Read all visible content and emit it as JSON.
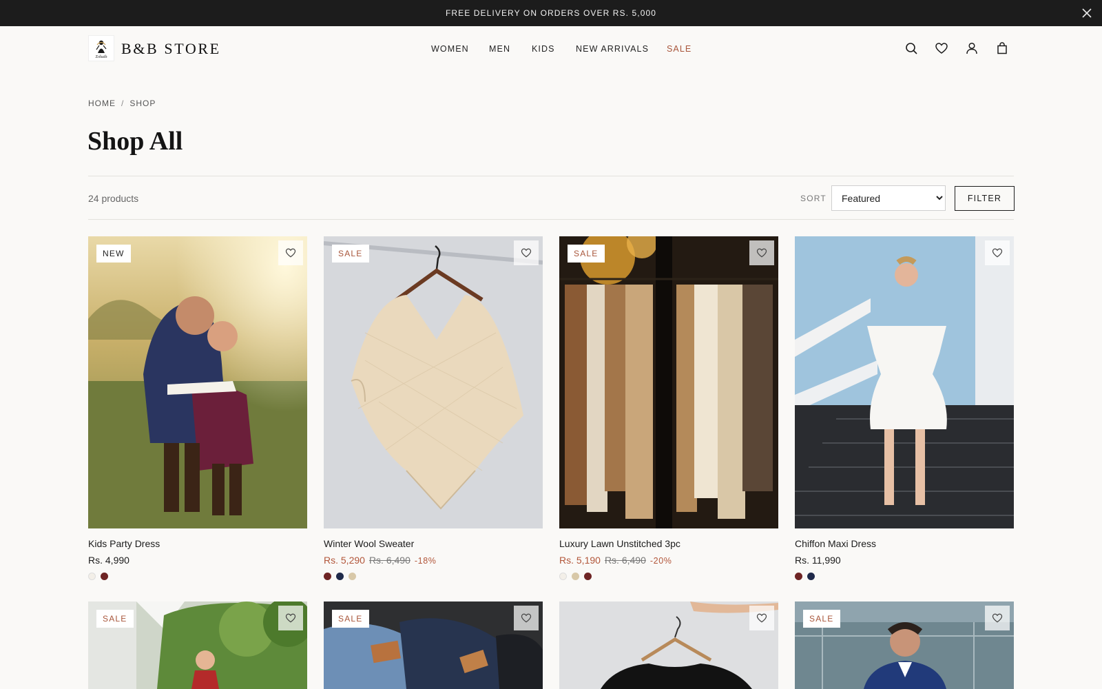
{
  "promo": {
    "text": "FREE DELIVERY ON ORDERS OVER RS. 5,000"
  },
  "header": {
    "logo_mark": "Zohaib",
    "logo_text": "B&B STORE",
    "nav": [
      {
        "label": "WOMEN"
      },
      {
        "label": "MEN"
      },
      {
        "label": "KIDS"
      },
      {
        "label": "NEW ARRIVALS"
      },
      {
        "label": "SALE"
      }
    ],
    "icons": [
      "search-icon",
      "heart-icon",
      "user-icon",
      "bag-icon"
    ]
  },
  "breadcrumb": {
    "home": "HOME",
    "separator": "/",
    "current": "SHOP"
  },
  "page": {
    "title": "Shop All"
  },
  "toolbar": {
    "count": "24 products",
    "sort_label": "SORT",
    "sort_value": "Featured",
    "filter_label": "FILTER"
  },
  "colors": {
    "accent": "#a8553a",
    "promo_bg": "#1c1c1c",
    "page_bg": "#faf9f7"
  },
  "products": [
    {
      "name": "Kids Party Dress",
      "badge": "NEW",
      "price": "Rs. 4,990",
      "swatches": [
        "#f3efe8",
        "#6e2424"
      ]
    },
    {
      "name": "Winter Wool Sweater",
      "badge": "SALE",
      "price": "Rs. 5,290",
      "old_price": "Rs. 6,490",
      "discount": "-18%",
      "swatches": [
        "#6e2424",
        "#1f2a4a",
        "#d8c8a8"
      ]
    },
    {
      "name": "Luxury Lawn Unstitched 3pc",
      "badge": "SALE",
      "price": "Rs. 5,190",
      "old_price": "Rs. 6,490",
      "discount": "-20%",
      "swatches": [
        "#f3efe8",
        "#d8c8a8",
        "#6e2424"
      ]
    },
    {
      "name": "Chiffon Maxi Dress",
      "price": "Rs. 11,990",
      "swatches": [
        "#6e2424",
        "#1f2a4a"
      ]
    },
    {
      "badge": "SALE"
    },
    {
      "badge": "SALE"
    },
    {},
    {
      "badge": "SALE"
    }
  ]
}
